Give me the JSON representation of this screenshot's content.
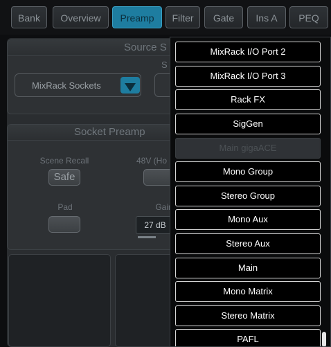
{
  "tabs": [
    {
      "label": "Bank",
      "active": false
    },
    {
      "label": "Overview",
      "active": false
    },
    {
      "label": "Preamp",
      "active": true
    },
    {
      "label": "Filter",
      "active": false
    },
    {
      "label": "Gate",
      "active": false
    },
    {
      "label": "Ins A",
      "active": false
    },
    {
      "label": "PEQ",
      "active": false
    }
  ],
  "source_section": {
    "title": "Source S",
    "sub_label": "S",
    "select_value": "MixRack Sockets"
  },
  "socket_preamp": {
    "title": "Socket Preamp",
    "scene_recall_label": "Scene Recall",
    "safe_button": "Safe",
    "phantom_label": "48V (Ho",
    "pad_label": "Pad",
    "gain_label": "Gain",
    "gain_value": "27 dB"
  },
  "dropdown": {
    "options": [
      {
        "label": "MixRack I/O Port 2",
        "enabled": true
      },
      {
        "label": "MixRack I/O Port 3",
        "enabled": true
      },
      {
        "label": "Rack FX",
        "enabled": true
      },
      {
        "label": "SigGen",
        "enabled": true
      },
      {
        "label": "Main gigaACE",
        "enabled": false
      },
      {
        "label": "Mono Group",
        "enabled": true
      },
      {
        "label": "Stereo Group",
        "enabled": true
      },
      {
        "label": "Mono Aux",
        "enabled": true
      },
      {
        "label": "Stereo Aux",
        "enabled": true
      },
      {
        "label": "Main",
        "enabled": true
      },
      {
        "label": "Mono Matrix",
        "enabled": true
      },
      {
        "label": "Stereo Matrix",
        "enabled": true
      },
      {
        "label": "PAFL",
        "enabled": true
      }
    ]
  },
  "colors": {
    "accent": "#1e7da0",
    "background": "#0d0e10",
    "option_border": "#d6d6d6"
  }
}
